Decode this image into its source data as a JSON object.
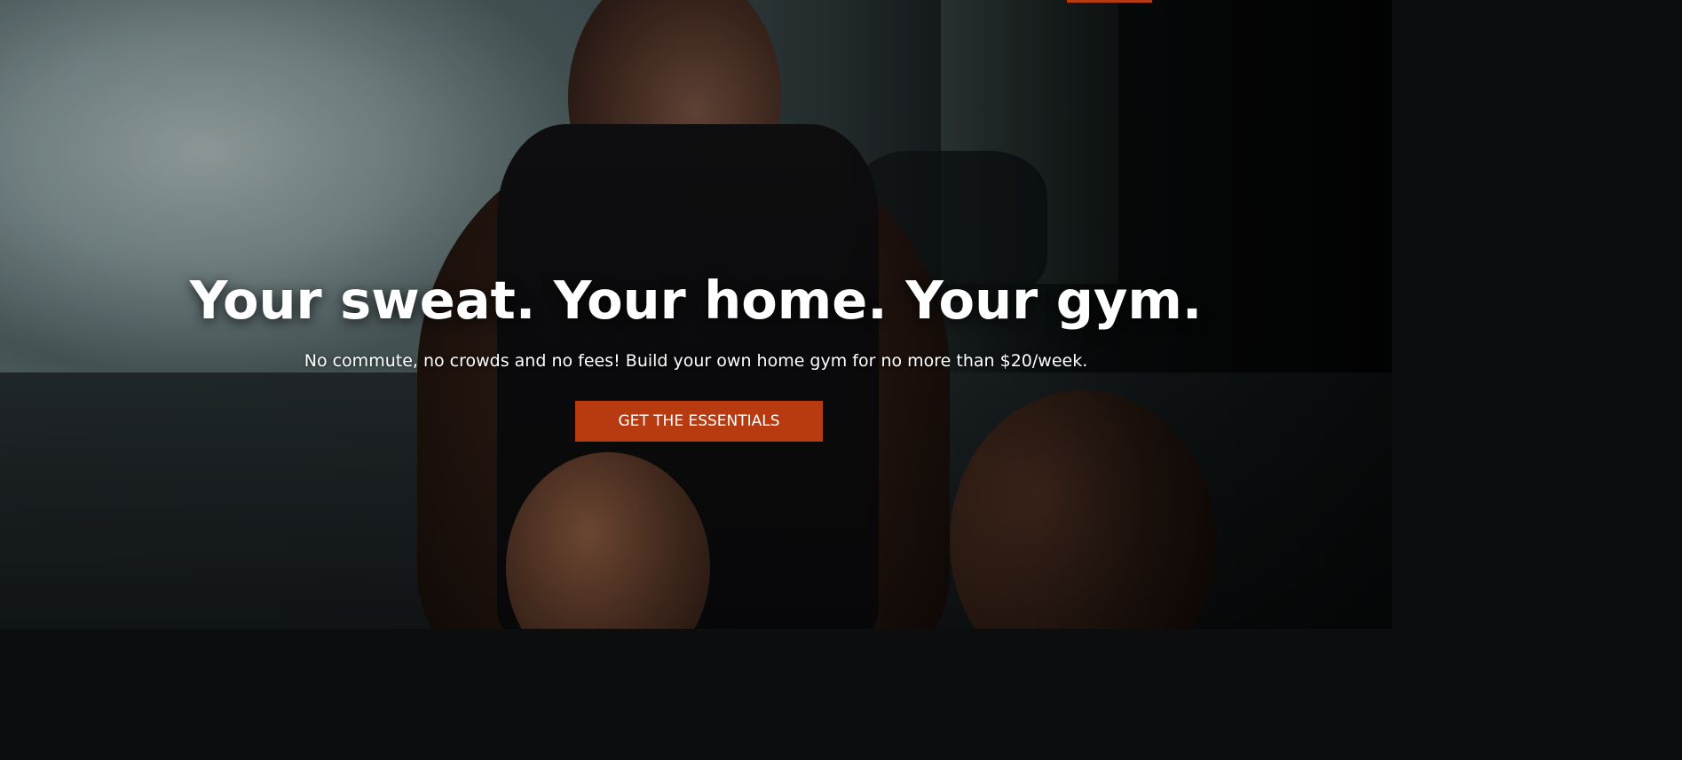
{
  "hero": {
    "headline": "Your sweat. Your home. Your gym.",
    "subheadline": "No commute, no crowds and no fees! Build your own home gym for no more than $20/week.",
    "cta_label": "GET THE ESSENTIALS",
    "background_image": "man-in-weighted-vest-sitting-on-gym-floor"
  },
  "colors": {
    "accent": "#b83a10",
    "text": "#ffffff"
  }
}
